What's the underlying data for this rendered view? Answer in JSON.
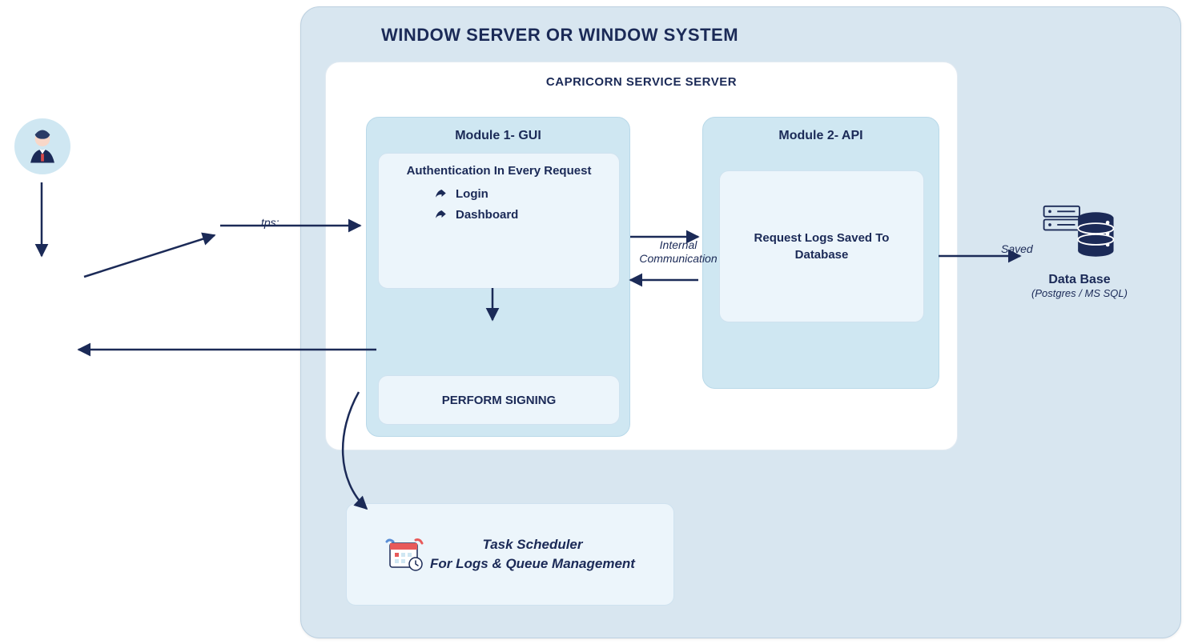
{
  "outer_title": "WINDOW SERVER OR WINDOW SYSTEM",
  "service_server_title": "CAPRICORN SERVICE SERVER",
  "module1": {
    "title": "Module 1- GUI",
    "auth_heading": "Authentication In Every Request",
    "items": [
      "Login",
      "Dashboard"
    ],
    "perform": "PERFORM SIGNING"
  },
  "module2": {
    "title": "Module 2- API",
    "logs": "Request Logs Saved To Database"
  },
  "labels": {
    "https": "tps:",
    "internal": "Internal Communication",
    "saved": "Saved"
  },
  "database": {
    "title": "Data Base",
    "sub": "(Postgres / MS SQL)"
  },
  "task": {
    "line1": "Task Scheduler",
    "line2": "For Logs & Queue Management"
  },
  "colors": {
    "navy": "#1b2a57",
    "panel": "#d8e6f0",
    "module": "#cfe7f2",
    "inner": "#ecf5fb"
  }
}
